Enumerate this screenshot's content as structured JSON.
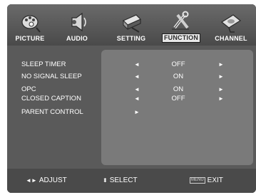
{
  "tabs": [
    {
      "label": "PICTURE",
      "icon": "picture-icon",
      "active": false
    },
    {
      "label": "AUDIO",
      "icon": "audio-icon",
      "active": false
    },
    {
      "label": "SETTING",
      "icon": "setting-icon",
      "active": false
    },
    {
      "label": "FUNCTION",
      "icon": "function-icon",
      "active": true
    },
    {
      "label": "CHANNEL",
      "icon": "channel-icon",
      "active": false
    }
  ],
  "settings": [
    {
      "name": "SLEEP TIMER",
      "value": "OFF"
    },
    {
      "name": "NO SIGNAL SLEEP",
      "value": "ON"
    },
    {
      "name": "OPC",
      "value": "ON"
    },
    {
      "name": "CLOSED CAPTION",
      "value": "OFF"
    },
    {
      "name": "PARENT CONTROL",
      "value": ""
    }
  ],
  "arrows": {
    "left": "◄",
    "right": "►"
  },
  "footer": {
    "adjust_symbol": "◄►",
    "adjust_label": "ADJUST",
    "select_symbol": "⬍",
    "select_label": "SELECT",
    "menu_key": "MENU",
    "exit_label": "EXIT"
  }
}
